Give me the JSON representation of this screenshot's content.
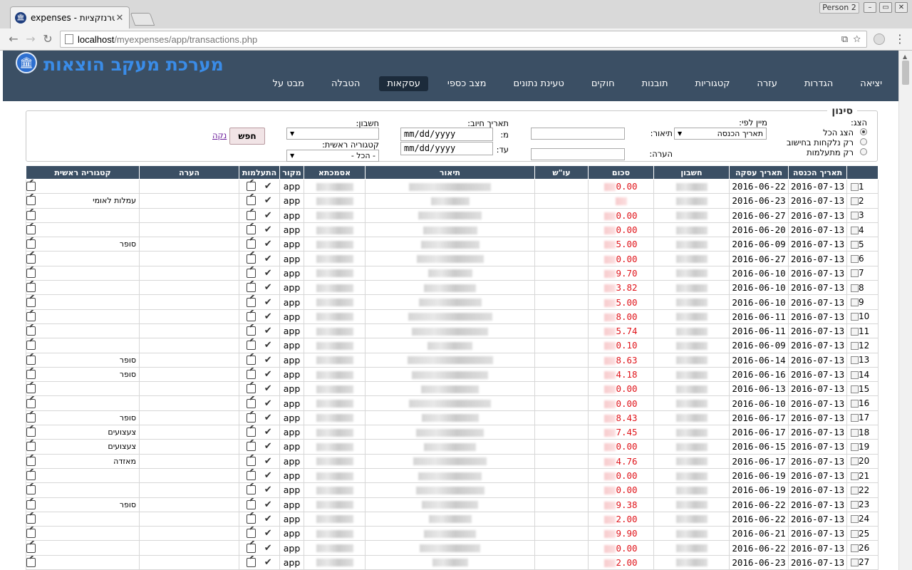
{
  "browser": {
    "tab_title": "expenses - טרנזקציות",
    "tab_favicon": "bank-icon",
    "person_label": "Person 2",
    "url_host": "localhost",
    "url_path": "/myexpenses/app/transactions.php"
  },
  "app": {
    "title": "מערכת מעקב הוצאות",
    "logo": "bank-icon",
    "nav": [
      {
        "label": "מבט על",
        "active": false
      },
      {
        "label": "הטבלה",
        "active": false
      },
      {
        "label": "עסקאות",
        "active": true
      },
      {
        "label": "מצב כספי",
        "active": false
      },
      {
        "label": "טעינת נתונים",
        "active": false
      },
      {
        "label": "חוקים",
        "active": false
      },
      {
        "label": "תובנות",
        "active": false
      },
      {
        "label": "קטגוריות",
        "active": false
      },
      {
        "label": "עזרה",
        "active": false
      },
      {
        "label": "הגדרות",
        "active": false
      },
      {
        "label": "יציאה",
        "active": false
      }
    ],
    "colors": {
      "header_bg": "#3b4f64",
      "title": "#3a8ce8",
      "amount": "#e0151b"
    }
  },
  "filter": {
    "legend": "סינון",
    "show_label": "הצג:",
    "radio_all": "הצג הכל",
    "radio_counted": "רק נלקחות בחישוב",
    "radio_ignored": "רק מתעלמות",
    "sort_label": "מיין לפי:",
    "sort_value": "תאריך הכנסה",
    "desc_label": "תיאור:",
    "note_label": "הערה:",
    "charge_date_label": "תאריך חיוב:",
    "from_label": "מ:",
    "to_label": "עד:",
    "date_placeholder": "mm/dd/yyyy",
    "account_label": "חשבון:",
    "account_value": "",
    "main_cat_label": "קטגוריה ראשית:",
    "main_cat_value": "- הכל -",
    "search_button": "חפש",
    "clear_link": "נקה"
  },
  "table": {
    "headers": [
      "",
      "תאריך הכנסה",
      "תאריך עסקה",
      "חשבון",
      "סכום",
      "עו\"ש",
      "תיאור",
      "אסמכתא",
      "מקור",
      "התעלמות",
      "הערה",
      "קטגוריה ראשית"
    ],
    "rows": [
      {
        "n": "1",
        "entry": "2016-07-13",
        "txn": "2016-06-22",
        "amt": "0.00",
        "src": "app",
        "cat": ""
      },
      {
        "n": "2",
        "entry": "2016-07-13",
        "txn": "2016-06-23",
        "amt": "",
        "src": "app",
        "cat": "עמלות לאומי"
      },
      {
        "n": "3",
        "entry": "2016-07-13",
        "txn": "2016-06-27",
        "amt": "0.00",
        "src": "app",
        "cat": ""
      },
      {
        "n": "4",
        "entry": "2016-07-13",
        "txn": "2016-06-20",
        "amt": "0.00",
        "src": "app",
        "cat": ""
      },
      {
        "n": "5",
        "entry": "2016-07-13",
        "txn": "2016-06-09",
        "amt": "5.00",
        "src": "app",
        "cat": "סופר"
      },
      {
        "n": "6",
        "entry": "2016-07-13",
        "txn": "2016-06-27",
        "amt": "0.00",
        "src": "app",
        "cat": ""
      },
      {
        "n": "7",
        "entry": "2016-07-13",
        "txn": "2016-06-10",
        "amt": "9.70",
        "src": "app",
        "cat": ""
      },
      {
        "n": "8",
        "entry": "2016-07-13",
        "txn": "2016-06-10",
        "amt": "3.82",
        "src": "app",
        "cat": ""
      },
      {
        "n": "9",
        "entry": "2016-07-13",
        "txn": "2016-06-10",
        "amt": "5.00",
        "src": "app",
        "cat": ""
      },
      {
        "n": "10",
        "entry": "2016-07-13",
        "txn": "2016-06-11",
        "amt": "8.00",
        "src": "app",
        "cat": ""
      },
      {
        "n": "11",
        "entry": "2016-07-13",
        "txn": "2016-06-11",
        "amt": "5.74",
        "src": "app",
        "cat": ""
      },
      {
        "n": "12",
        "entry": "2016-07-13",
        "txn": "2016-06-09",
        "amt": "0.10",
        "src": "app",
        "cat": ""
      },
      {
        "n": "13",
        "entry": "2016-07-13",
        "txn": "2016-06-14",
        "amt": "8.63",
        "src": "app",
        "cat": "סופר"
      },
      {
        "n": "14",
        "entry": "2016-07-13",
        "txn": "2016-06-16",
        "amt": "4.18",
        "src": "app",
        "cat": "סופר"
      },
      {
        "n": "15",
        "entry": "2016-07-13",
        "txn": "2016-06-13",
        "amt": "0.00",
        "src": "app",
        "cat": ""
      },
      {
        "n": "16",
        "entry": "2016-07-13",
        "txn": "2016-06-10",
        "amt": "0.00",
        "src": "app",
        "cat": ""
      },
      {
        "n": "17",
        "entry": "2016-07-13",
        "txn": "2016-06-17",
        "amt": "8.43",
        "src": "app",
        "cat": "סופר"
      },
      {
        "n": "18",
        "entry": "2016-07-13",
        "txn": "2016-06-17",
        "amt": "7.45",
        "src": "app",
        "cat": "צעצועים"
      },
      {
        "n": "19",
        "entry": "2016-07-13",
        "txn": "2016-06-15",
        "amt": "0.00",
        "src": "app",
        "cat": "צעצועים"
      },
      {
        "n": "20",
        "entry": "2016-07-13",
        "txn": "2016-06-17",
        "amt": "4.76",
        "src": "app",
        "cat": "מאזדה"
      },
      {
        "n": "21",
        "entry": "2016-07-13",
        "txn": "2016-06-19",
        "amt": "0.00",
        "src": "app",
        "cat": ""
      },
      {
        "n": "22",
        "entry": "2016-07-13",
        "txn": "2016-06-19",
        "amt": "0.00",
        "src": "app",
        "cat": ""
      },
      {
        "n": "23",
        "entry": "2016-07-13",
        "txn": "2016-06-22",
        "amt": "9.38",
        "src": "app",
        "cat": "סופר"
      },
      {
        "n": "24",
        "entry": "2016-07-13",
        "txn": "2016-06-22",
        "amt": "2.00",
        "src": "app",
        "cat": ""
      },
      {
        "n": "25",
        "entry": "2016-07-13",
        "txn": "2016-06-21",
        "amt": "9.90",
        "src": "app",
        "cat": ""
      },
      {
        "n": "26",
        "entry": "2016-07-13",
        "txn": "2016-06-22",
        "amt": "0.00",
        "src": "app",
        "cat": ""
      },
      {
        "n": "27",
        "entry": "2016-07-13",
        "txn": "2016-06-23",
        "amt": "2.00",
        "src": "app",
        "cat": ""
      }
    ]
  }
}
